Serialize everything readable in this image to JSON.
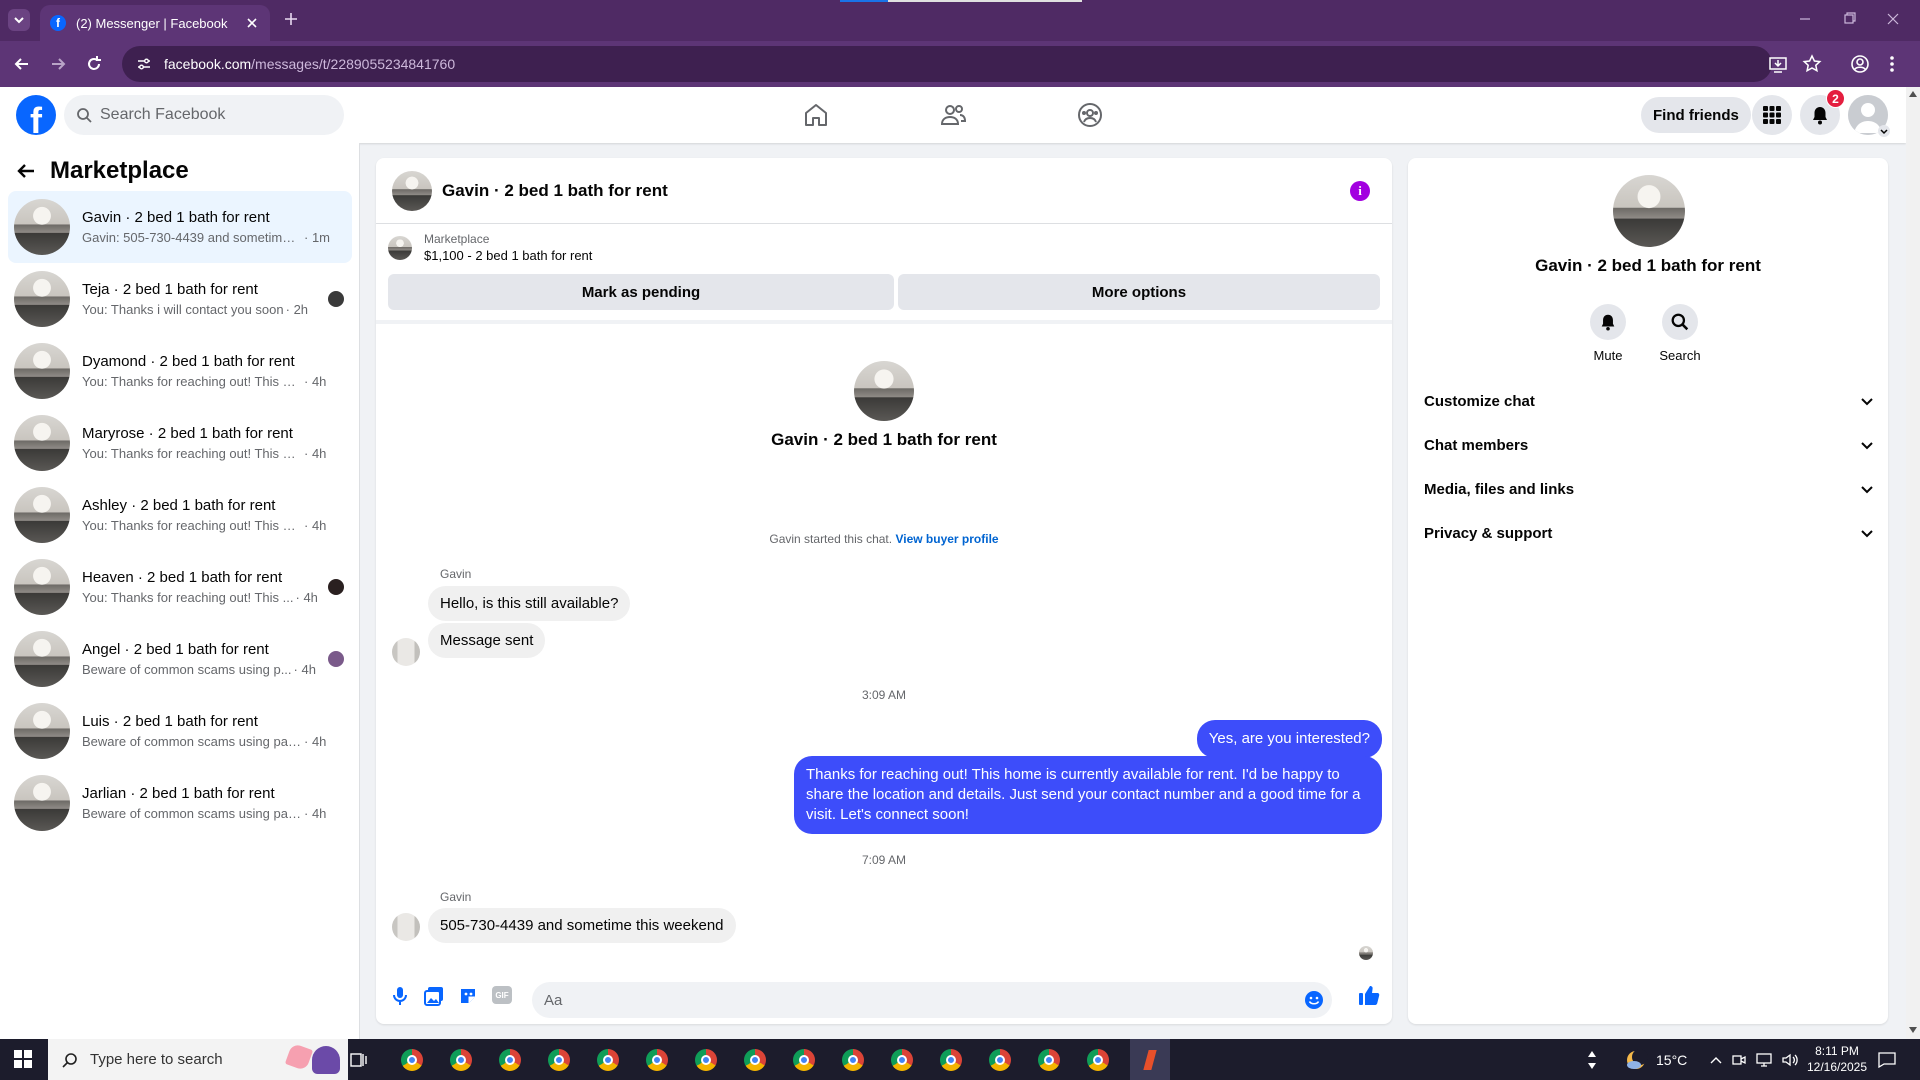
{
  "browser": {
    "tab_title": "(2) Messenger | Facebook",
    "url_domain": "facebook.com",
    "url_path": "/messages/t/2289055234841760"
  },
  "header": {
    "search_placeholder": "Search Facebook",
    "find_friends_label": "Find friends",
    "notification_count": "2"
  },
  "sidebar": {
    "title": "Marketplace",
    "conversations": [
      {
        "name": "Gavin · 2 bed 1 bath for rent",
        "preview": "Gavin: 505-730-4439 and sometime t...",
        "time": "· 1m",
        "bold": true,
        "active": true
      },
      {
        "name": "Teja · 2 bed 1 bath for rent",
        "preview": "You: Thanks i will contact you soon",
        "time": "· 2h"
      },
      {
        "name": "Dyamond · 2 bed 1 bath for rent",
        "preview": "You: Thanks for reaching out! This ho...",
        "time": "· 4h"
      },
      {
        "name": "Maryrose · 2 bed 1 bath for rent",
        "preview": "You: Thanks for reaching out! This ho...",
        "time": "· 4h"
      },
      {
        "name": "Ashley · 2 bed 1 bath for rent",
        "preview": "You: Thanks for reaching out! This ho...",
        "time": "· 4h"
      },
      {
        "name": "Heaven · 2 bed 1 bath for rent",
        "preview": "You: Thanks for reaching out! This ...",
        "time": "· 4h"
      },
      {
        "name": "Angel · 2 bed 1 bath for rent",
        "preview": "Beware of common scams using p...",
        "time": "· 4h"
      },
      {
        "name": "Luis · 2 bed 1 bath for rent",
        "preview": "Beware of common scams using pay...",
        "time": "· 4h"
      },
      {
        "name": "Jarlian · 2 bed 1 bath for rent",
        "preview": "Beware of common scams using pay...",
        "time": "· 4h"
      }
    ]
  },
  "chat": {
    "title": "Gavin · 2 bed 1 bath for rent",
    "marketplace_label": "Marketplace",
    "listing": "$1,100 - 2 bed 1 bath for rent",
    "mark_pending_label": "Mark as pending",
    "more_options_label": "More options",
    "hero_name": "Gavin · 2 bed 1 bath for rent",
    "started_text": "Gavin started this chat.",
    "view_buyer_profile": "View buyer profile",
    "sender_1": "Gavin",
    "msg_1": "Hello, is this still available?",
    "msg_2": "Message sent",
    "time_1": "3:09 AM",
    "msg_3": "Yes, are you interested?",
    "msg_4": "Thanks for reaching out! This home is currently available for rent. I'd be happy to share the location and details. Just send your contact number and a good time for a visit. Let's connect soon!",
    "time_2": "7:09 AM",
    "sender_2": "Gavin",
    "msg_5": "505-730-4439 and sometime this weekend",
    "composer_placeholder": "Aa",
    "gif_label": "GIF"
  },
  "details": {
    "name": "Gavin · 2 bed 1 bath for rent",
    "mute_label": "Mute",
    "search_label": "Search",
    "rows": [
      "Customize chat",
      "Chat members",
      "Media, files and links",
      "Privacy & support"
    ]
  },
  "taskbar": {
    "search_placeholder": "Type here to search",
    "temperature": "15°C",
    "time": "8:11 PM",
    "date": "12/16/2025"
  },
  "colors": {
    "fb_blue": "#0866ff",
    "out_bubble": "#3d4dfa",
    "badge_red": "#e41e3f",
    "info_purple": "#a200e0",
    "chrome_purple": "#5d3576"
  }
}
